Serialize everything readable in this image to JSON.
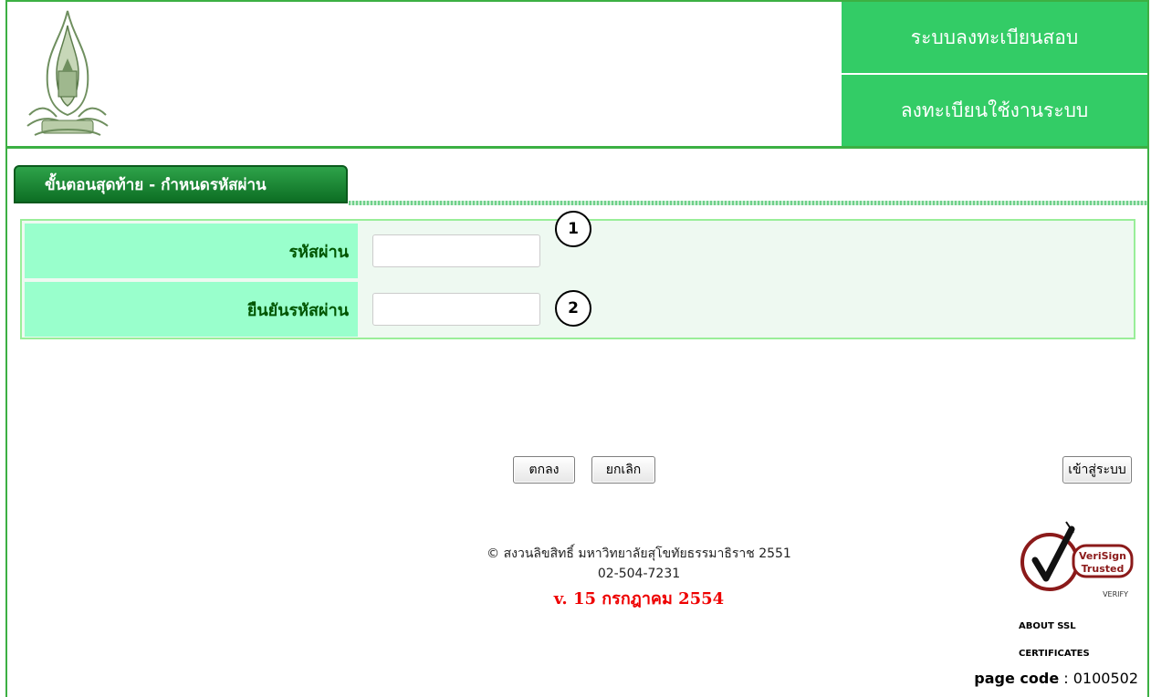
{
  "header": {
    "nav": [
      "ระบบลงทะเบียนสอบ",
      "ลงทะเบียนใช้งานระบบ"
    ]
  },
  "tab": {
    "title": "ขั้นตอนสุดท้าย - กำหนดรหัสผ่าน"
  },
  "form": {
    "rows": [
      {
        "label": "รหัสผ่าน",
        "value": "",
        "marker": "1"
      },
      {
        "label": "ยืนยันรหัสผ่าน",
        "value": "",
        "marker": "2"
      }
    ]
  },
  "buttons": {
    "ok": "ตกลง",
    "cancel": "ยกเลิก",
    "login": "เข้าสู่ระบบ"
  },
  "footer": {
    "copyright": "© สงวนลิขสิทธิ์ มหาวิทยาลัยสุโขทัยธรรมาธิราช 2551",
    "phone": "02-504-7231",
    "version": "v. 15 กรกฎาคม 2554"
  },
  "verisign": {
    "brand": "VeriSign",
    "trusted": "Trusted",
    "verify": "VERIFY",
    "about_line1": "ABOUT SSL",
    "about_line2": "CERTIFICATES"
  },
  "page_code": {
    "label": "page code",
    "value": "0100502"
  },
  "colors": {
    "green": "#33cc66",
    "label_bg": "#99ffcc",
    "version_red": "#ee0000"
  },
  "icons": {
    "logo": "university-emblem-icon",
    "seal": "verisign-seal-icon"
  }
}
